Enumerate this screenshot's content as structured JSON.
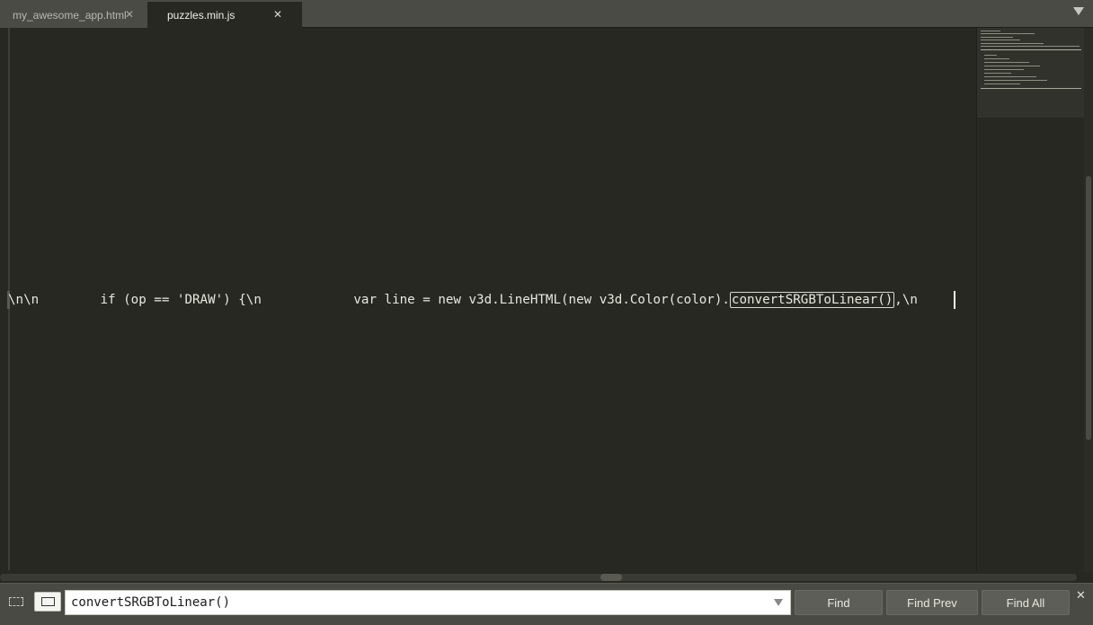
{
  "tabs": [
    {
      "label": "my_awesome_app.html",
      "active": false
    },
    {
      "label": "puzzles.min.js",
      "active": true
    }
  ],
  "tab_close_glyph": "✕",
  "editor": {
    "code_before": "\\n\\n        if (op == 'DRAW') {\\n            var line = new v3d.LineHTML(new v3d.Color(color).",
    "code_match": "convertSRGBToLinear()",
    "code_after": ",\\n"
  },
  "find": {
    "query": "convertSRGBToLinear()",
    "find_label": "Find",
    "find_prev_label": "Find Prev",
    "find_all_label": "Find All",
    "close_glyph": "✕"
  },
  "icons": {
    "tab_overflow": "chevron-down-icon",
    "in_selection": "in-selection-icon",
    "wrap": "wrap-icon"
  },
  "colors": {
    "editor_bg": "#272822",
    "tabbar_bg": "#4b4b46",
    "findpanel_bg": "#4a4a45"
  }
}
